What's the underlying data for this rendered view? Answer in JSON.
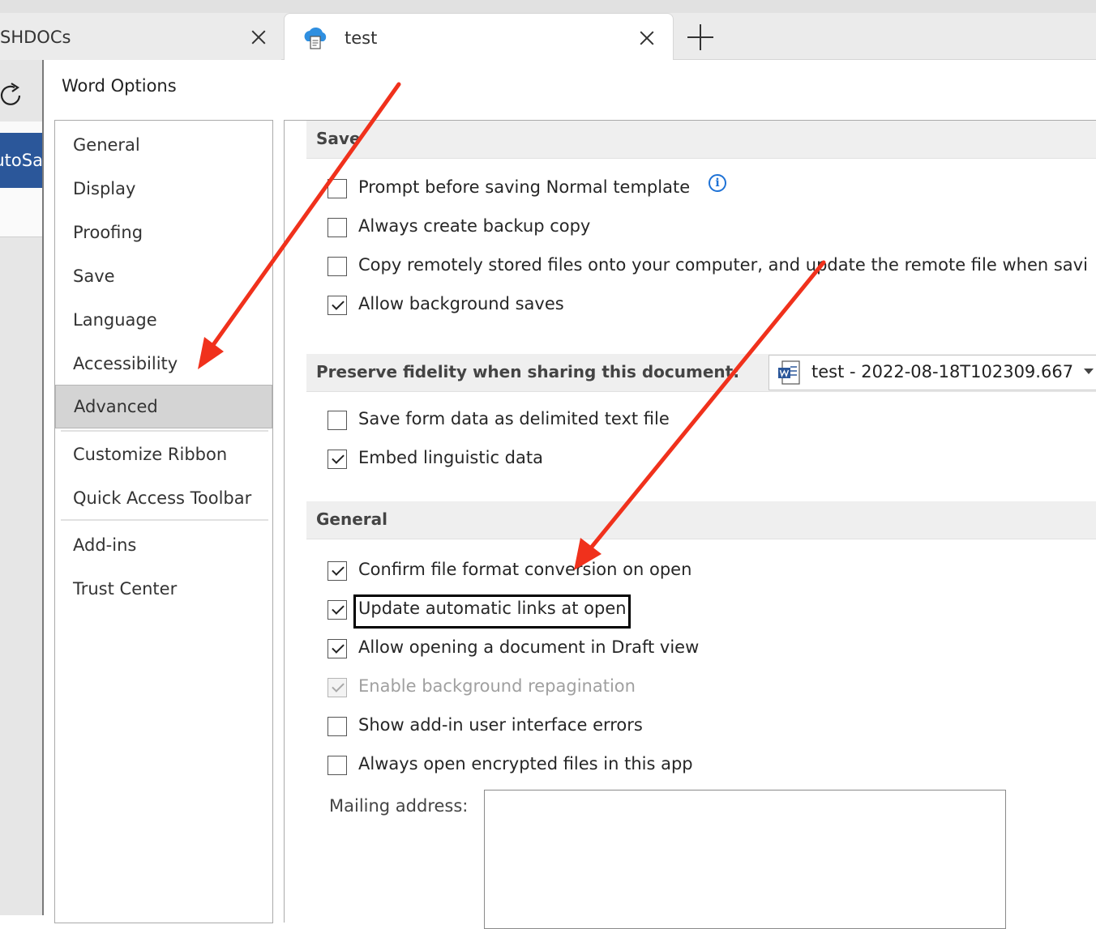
{
  "browser": {
    "tabs": [
      {
        "title": "SHDOCs"
      },
      {
        "title": "test"
      }
    ]
  },
  "background_app": {
    "autosave_text": "AutoSave"
  },
  "dialog": {
    "title": "Word Options",
    "nav": [
      {
        "label": "General"
      },
      {
        "label": "Display"
      },
      {
        "label": "Proofing"
      },
      {
        "label": "Save"
      },
      {
        "label": "Language"
      },
      {
        "label": "Accessibility"
      },
      {
        "label": "Advanced",
        "selected": true
      },
      {
        "label": "Customize Ribbon"
      },
      {
        "label": "Quick Access Toolbar"
      },
      {
        "label": "Add-ins"
      },
      {
        "label": "Trust Center"
      }
    ],
    "sections": {
      "save": {
        "title": "Save",
        "options": [
          {
            "label": "Prompt before saving Normal template",
            "checked": false
          },
          {
            "label": "Always create backup copy",
            "checked": false
          },
          {
            "label": "Copy remotely stored files onto your computer, and update the remote file when savi",
            "checked": false
          },
          {
            "label": "Allow background saves",
            "checked": true
          }
        ]
      },
      "fidelity": {
        "title": "Preserve fidelity when sharing this document:",
        "document": "test - 2022-08-18T102309.667",
        "options": [
          {
            "label": "Save form data as delimited text file",
            "checked": false
          },
          {
            "label": "Embed linguistic data",
            "checked": true
          }
        ]
      },
      "general": {
        "title": "General",
        "options": [
          {
            "label": "Confirm file format conversion on open",
            "checked": true
          },
          {
            "label": "Update automatic links at open",
            "checked": true
          },
          {
            "label": "Allow opening a document in Draft view",
            "checked": true
          },
          {
            "label": "Enable background repagination",
            "checked": true,
            "disabled": true
          },
          {
            "label": "Show add-in user interface errors",
            "checked": false
          },
          {
            "label": "Always open encrypted files in this app",
            "checked": false
          }
        ],
        "mailing_label": "Mailing address:",
        "mailing_value": ""
      }
    }
  },
  "colors": {
    "accent": "#2b579a",
    "annotation_arrow": "#f0311c",
    "info": "#1e72d6"
  },
  "icons": [
    "cloud-document-icon",
    "close-icon",
    "plus-icon",
    "refresh-icon",
    "info-icon",
    "word-document-icon",
    "chevron-down-icon"
  ]
}
